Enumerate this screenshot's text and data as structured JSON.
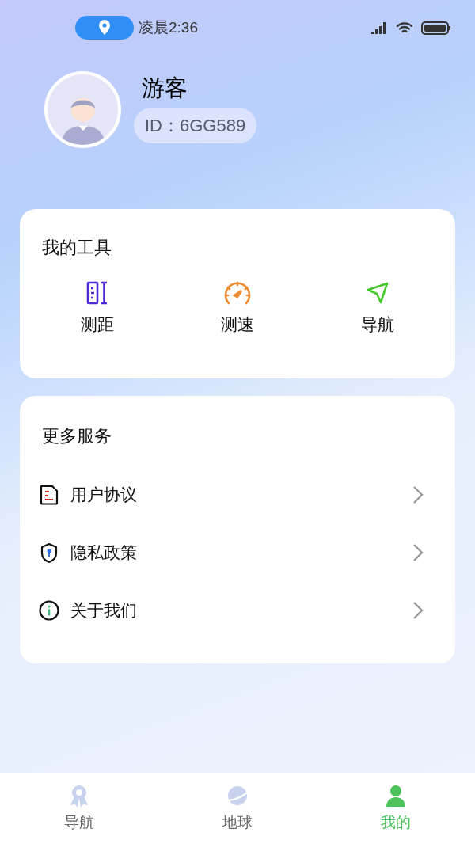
{
  "status_bar": {
    "time": "凌晨2:36"
  },
  "profile": {
    "name": "游客",
    "id": "ID：6GG589"
  },
  "tools": {
    "title": "我的工具",
    "items": [
      {
        "kind": "ruler",
        "label": "测距"
      },
      {
        "kind": "speedometer",
        "label": "测速"
      },
      {
        "kind": "navigation",
        "label": "导航"
      }
    ]
  },
  "services": {
    "title": "更多服务",
    "items": [
      {
        "kind": "document",
        "label": "用户协议"
      },
      {
        "kind": "shield",
        "label": "隐私政策"
      },
      {
        "kind": "info",
        "label": "关于我们"
      }
    ]
  },
  "tab_bar": [
    {
      "kind": "medal",
      "label": "导航",
      "selected": false
    },
    {
      "kind": "planet",
      "label": "地球",
      "selected": false
    },
    {
      "kind": "person",
      "label": "我的",
      "selected": true
    }
  ]
}
